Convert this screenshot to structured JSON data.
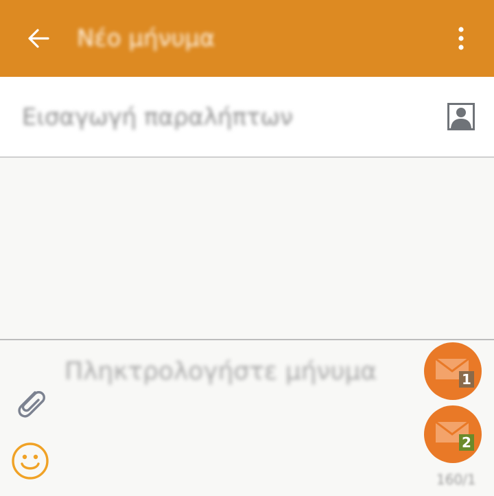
{
  "app_bar": {
    "title": "Νέο μήνυμα",
    "icons": {
      "back": "arrow-left-icon",
      "menu": "more-vertical-icon"
    }
  },
  "recipients": {
    "placeholder": "Εισαγωγή παραλήπτων",
    "contact_icon": "contact-icon"
  },
  "compose": {
    "placeholder": "Πληκτρολογήστε μήνυμα",
    "counter": "160/1",
    "attach_icon": "paperclip-icon",
    "emoji_icon": "smiley-icon",
    "send_sim1": {
      "icon": "envelope-sim-icon",
      "badge": "1"
    },
    "send_sim2": {
      "icon": "envelope-sim-icon",
      "badge": "2"
    }
  },
  "colors": {
    "app_bar": "#dd8a22",
    "send_button": "#e97927",
    "sim1_badge": "#8a6a4a",
    "sim2_badge": "#6b8a2a",
    "emoji_icon": "#f0a226",
    "attach_icon": "#7c8290"
  }
}
